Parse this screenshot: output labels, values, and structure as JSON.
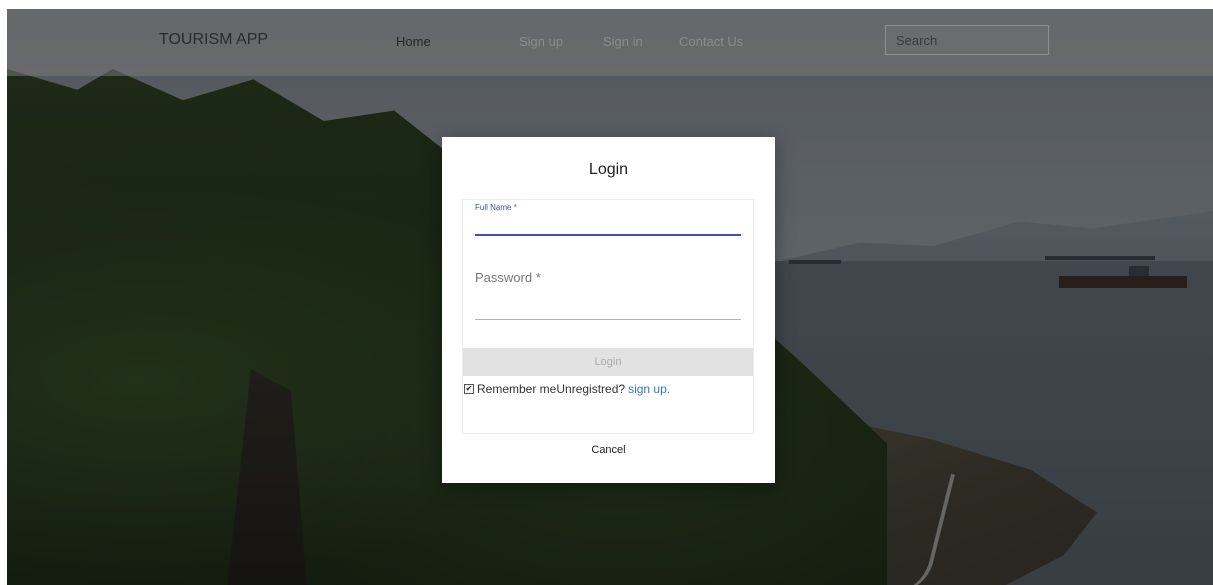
{
  "navbar": {
    "brand": "TOURISM APP",
    "links": [
      {
        "label": "Home",
        "active": true
      },
      {
        "label": "Sign up",
        "active": false
      },
      {
        "label": "Sign in",
        "active": false
      },
      {
        "label": "Contact Us",
        "active": false
      }
    ],
    "search_placeholder": "Search"
  },
  "modal": {
    "title": "Login",
    "fullname_label": "Full Name",
    "password_label": "Password",
    "required_marker": "*",
    "login_button": "Login",
    "remember_checked": true,
    "remember_label": "Remember me",
    "unregistered_text": "Unregistred?",
    "signup_link": "sign up.",
    "cancel_button": "Cancel"
  },
  "colors": {
    "accent": "#3f51b5",
    "link": "#337ab7",
    "required": "#e53935"
  }
}
